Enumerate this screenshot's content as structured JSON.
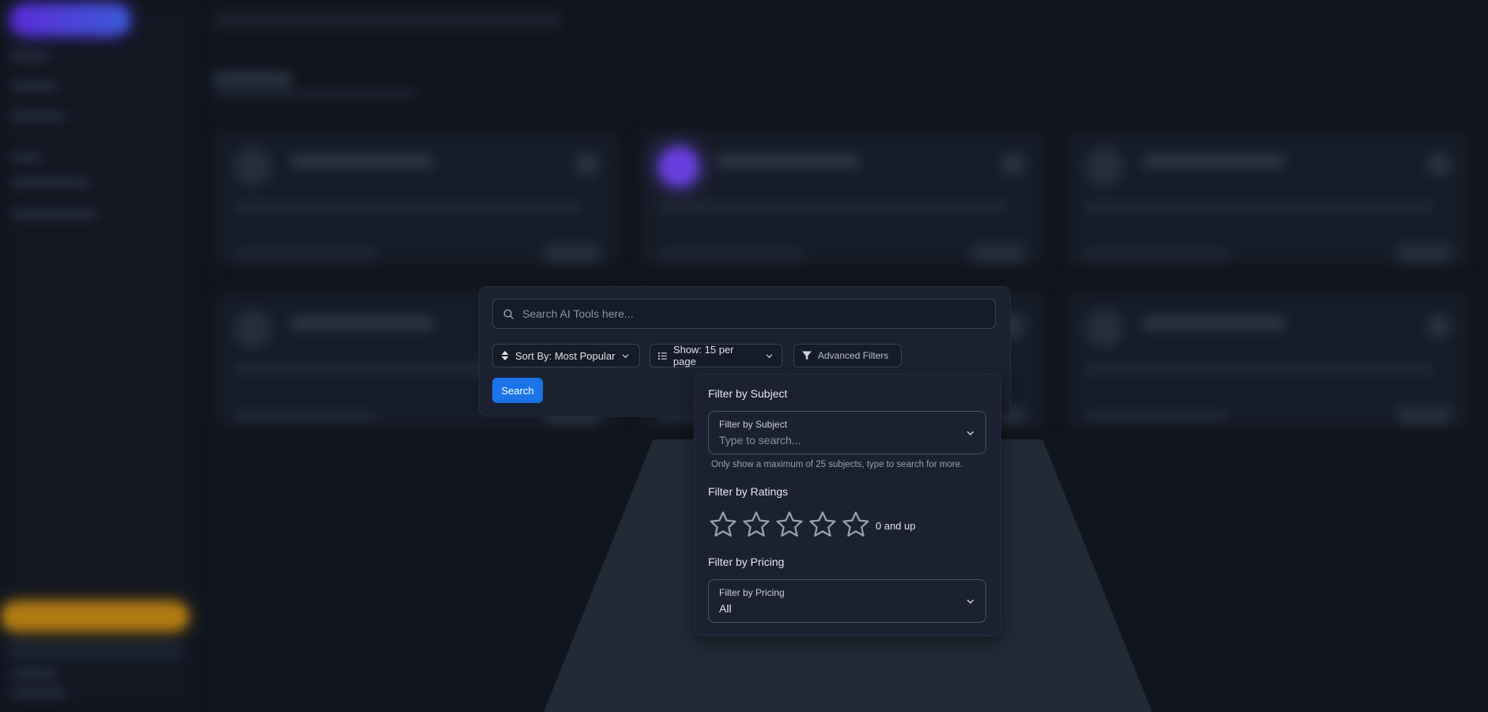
{
  "search": {
    "placeholder": "Search AI Tools here...",
    "sort_label": "Sort By: Most Popular",
    "show_label": "Show: 15 per page",
    "advanced_label": "Advanced Filters",
    "button_label": "Search"
  },
  "filters": {
    "subject": {
      "section_title": "Filter by Subject",
      "field_label": "Filter by Subject",
      "placeholder": "Type to search...",
      "hint": "Only show a maximum of 25 subjects, type to search for more."
    },
    "ratings": {
      "section_title": "Filter by Ratings",
      "value_label": "0 and up",
      "max_stars": 5,
      "selected": 0
    },
    "pricing": {
      "section_title": "Filter by Pricing",
      "field_label": "Filter by Pricing",
      "value": "All"
    }
  },
  "icons": {
    "search": "search-icon",
    "sort": "sort-arrows-icon",
    "list": "list-icon",
    "chevron": "chevron-down-icon",
    "filter": "filter-funnel-icon",
    "star": "star-outline-icon"
  },
  "colors": {
    "accent": "#1a73e8",
    "panel": "#1b2130",
    "background": "#0f141d"
  }
}
